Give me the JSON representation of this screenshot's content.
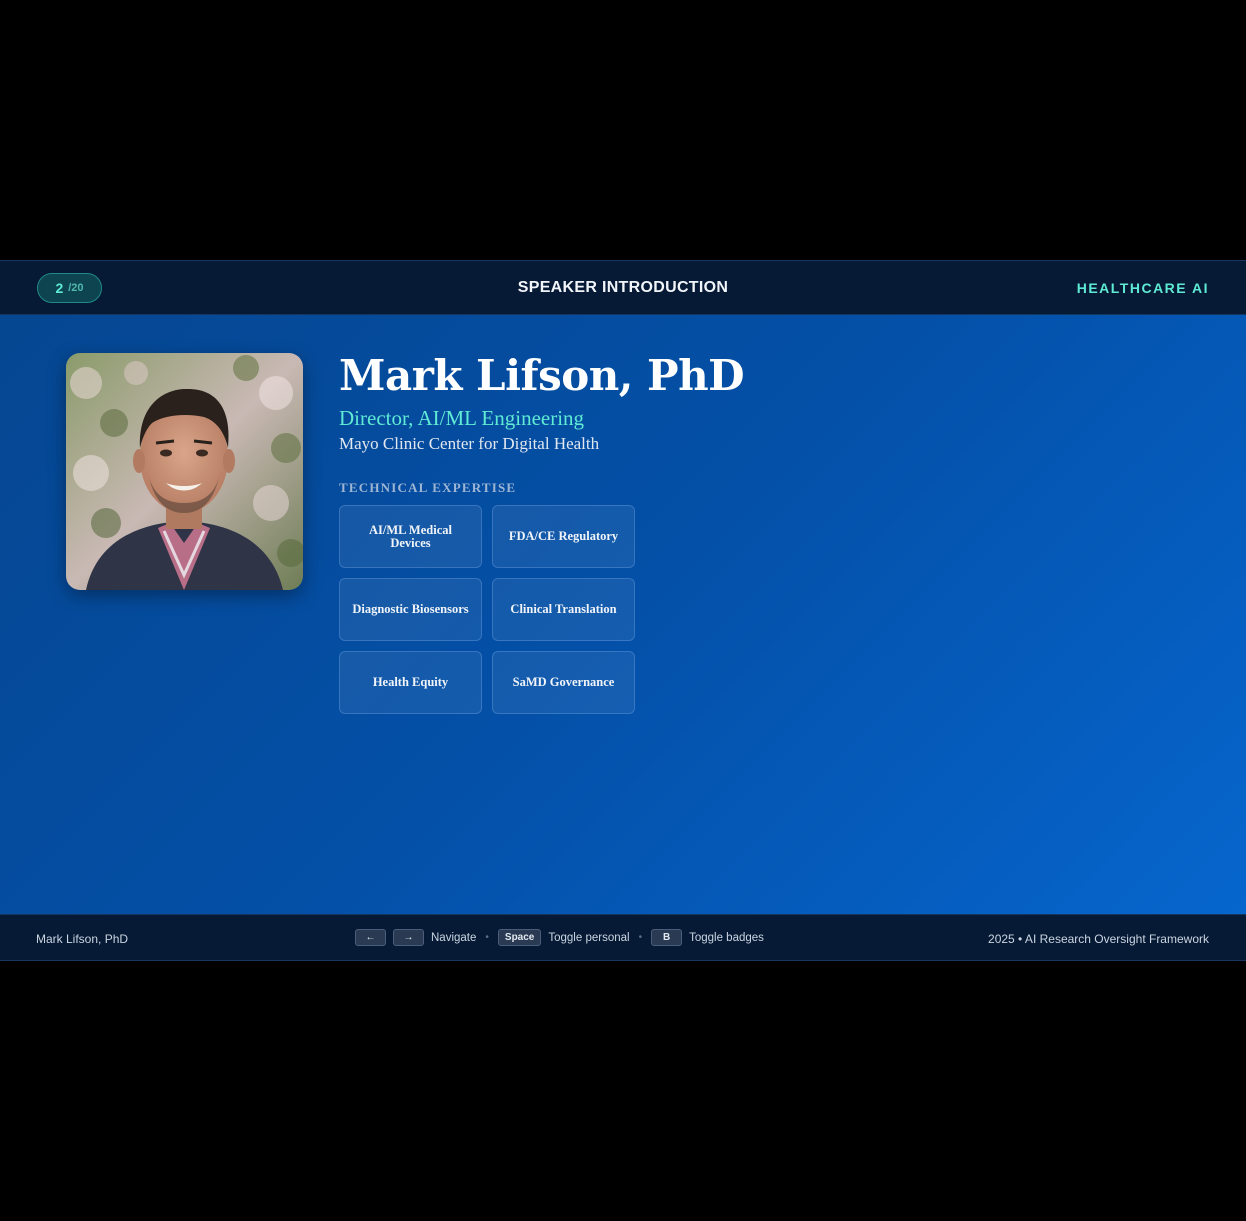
{
  "header": {
    "slide_current": "2",
    "slide_total": "/20",
    "title": "SPEAKER INTRODUCTION",
    "brand": "HEALTHCARE AI"
  },
  "speaker": {
    "name": "Mark Lifson, PhD",
    "role": "Director, AI/ML Engineering",
    "organization": "Mayo Clinic Center for Digital Health",
    "expertise_label": "TECHNICAL EXPERTISE",
    "expertise": [
      "AI/ML Medical Devices",
      "FDA/CE Regulatory",
      "Diagnostic Biosensors",
      "Clinical Translation",
      "Health Equity",
      "SaMD Governance"
    ]
  },
  "footer": {
    "left": "Mark Lifson, PhD",
    "keys": {
      "prev": "←",
      "next": "→",
      "navigate": "Navigate",
      "space": "Space",
      "toggle_personal": "Toggle personal",
      "b": "B",
      "toggle_badges": "Toggle badges",
      "separator": "•"
    },
    "right": "2025 • AI Research Oversight Framework"
  },
  "colors": {
    "accent": "#5eead4",
    "bar": "#061a35",
    "slide_start": "#064690",
    "slide_end": "#0667cf"
  }
}
